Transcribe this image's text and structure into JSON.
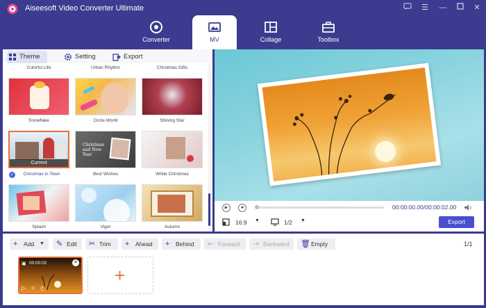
{
  "app": {
    "title": "Aiseesoft Video Converter Ultimate"
  },
  "nav": {
    "tabs": [
      {
        "label": "Converter",
        "icon": "converter-icon"
      },
      {
        "label": "MV",
        "icon": "mv-icon"
      },
      {
        "label": "Collage",
        "icon": "collage-icon"
      },
      {
        "label": "Toolbox",
        "icon": "toolbox-icon"
      }
    ],
    "active": "MV"
  },
  "subtabs": [
    {
      "label": "Theme",
      "icon": "theme-grid-icon"
    },
    {
      "label": "Setting",
      "icon": "gear-icon"
    },
    {
      "label": "Export",
      "icon": "export-icon"
    }
  ],
  "themes": {
    "top_row_labels": [
      "Colorful Life",
      "Urban Rhythm",
      "Christmas Gifts"
    ],
    "items": [
      {
        "label": "Snowflake"
      },
      {
        "label": "Circle World"
      },
      {
        "label": "Shining Star"
      },
      {
        "label": "Christmas in Town",
        "current": true
      },
      {
        "label": "Best Wishes"
      },
      {
        "label": "White Christmas"
      },
      {
        "label": "Splash"
      },
      {
        "label": "Vigor"
      },
      {
        "label": "Autumn"
      }
    ],
    "current_badge": "Current",
    "best_wishes_text": "Christmas and New Year"
  },
  "player": {
    "time": "00:00:00.00/00:00:02.00",
    "aspect": "16:9",
    "page": "1/2",
    "export_label": "Export"
  },
  "toolbar": {
    "add": "Add",
    "edit": "Edit",
    "trim": "Trim",
    "ahead": "Ahead",
    "behind": "Behind",
    "forward": "Forward",
    "backward": "Backward",
    "empty": "Empty",
    "page_indicator": "1/1"
  },
  "timeline": {
    "clip_time": "00:00:02"
  },
  "colors": {
    "brand": "#3b3b8f",
    "accent": "#e8703a",
    "export": "#4a4fd0"
  }
}
